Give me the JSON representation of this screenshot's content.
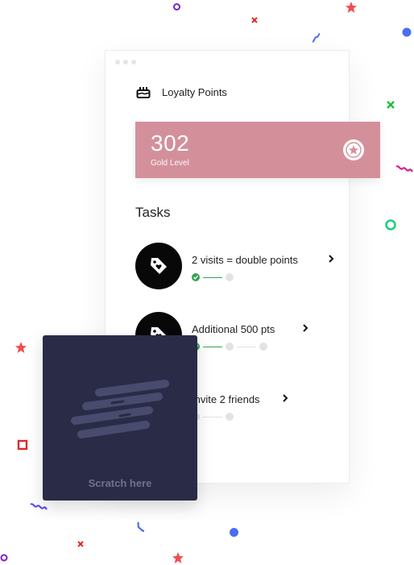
{
  "card": {
    "title": "Loyalty Points",
    "title_icon": "cake-icon"
  },
  "points": {
    "value": "302",
    "level": "Gold Level",
    "color": "#d3909b",
    "badge_icon": "star-icon"
  },
  "tasks": {
    "heading": "Tasks",
    "items": [
      {
        "label": "2 visits = double points",
        "icon": "heart-tag-icon",
        "steps_total": 2,
        "steps_done": 1
      },
      {
        "label": "Additional 500 pts",
        "icon": "heart-tag-icon",
        "steps_total": 3,
        "steps_done": 1
      },
      {
        "label": "Invite 2 friends",
        "icon": "heart-tag-icon",
        "steps_total": 2,
        "steps_done": 0
      }
    ]
  },
  "scratch_card": {
    "label": "Scratch here",
    "background": "#2a2c47"
  },
  "colors": {
    "success": "#37a153",
    "confetti": [
      "#7b1fd1",
      "#e02828",
      "#f04d50",
      "#4c6cf2",
      "#1bc23a",
      "#d81b8c",
      "#1bd17b",
      "#5a4cf2"
    ]
  }
}
